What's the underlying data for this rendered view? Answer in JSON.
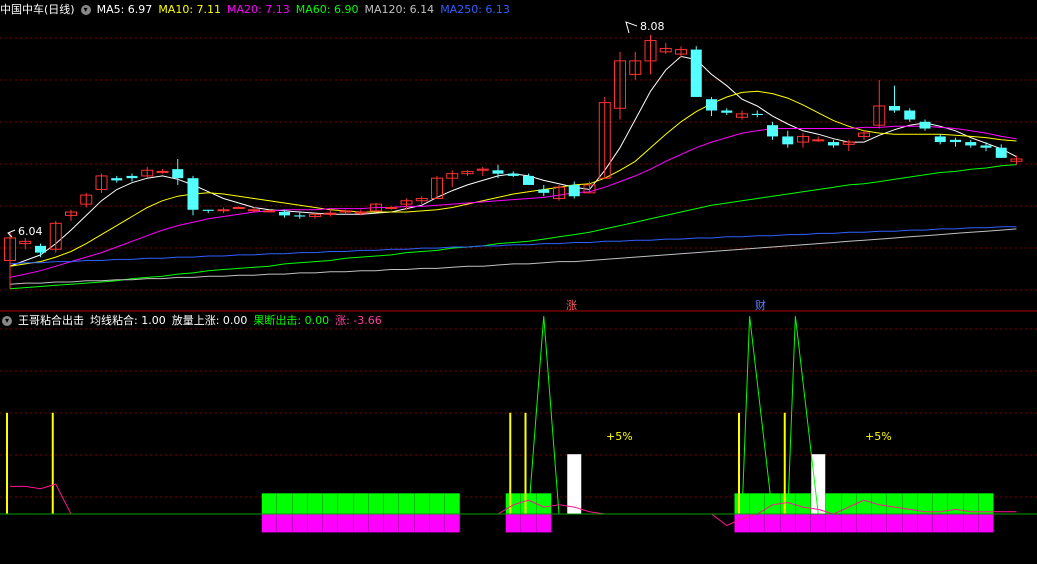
{
  "main_header": {
    "title": "中国中车(日线)",
    "indicators": [
      {
        "label": "MA5: 6.97",
        "color": "#ffffff"
      },
      {
        "label": "MA10: 7.11",
        "color": "#ffff00"
      },
      {
        "label": "MA20: 7.13",
        "color": "#ff00ff"
      },
      {
        "label": "MA60: 6.90",
        "color": "#00ff00"
      },
      {
        "label": "MA120: 6.14",
        "color": "#c0c0c0"
      },
      {
        "label": "MA250: 6.13",
        "color": "#3060ff"
      }
    ]
  },
  "sub_header": {
    "title": "王哥粘合出击",
    "indicators": [
      {
        "label": "均线粘合: 1.00",
        "color": "#ffffff"
      },
      {
        "label": "放量上涨: 0.00",
        "color": "#ffffff"
      },
      {
        "label": "果断出击: 0.00",
        "color": "#00ff00"
      },
      {
        "label": "涨: -3.66",
        "color": "#ff40a0"
      }
    ]
  },
  "annotations": {
    "high_label": "8.08",
    "low_label": "6.04",
    "event_zhang": "涨",
    "event_cai": "财",
    "plus5_a": "+5%",
    "plus5_b": "+5%"
  },
  "colors": {
    "up": "#ff3232",
    "down": "#54ffff",
    "grid": "#800000",
    "ma5": "#ffffff",
    "ma10": "#ffff00",
    "ma20": "#ff00ff",
    "ma60": "#00ff00",
    "ma120": "#c0c0c0",
    "ma250": "#3060ff"
  },
  "chart_data": [
    {
      "type": "candlestick",
      "title": "中国中车(日线)",
      "y_range": [
        5.7,
        8.2
      ],
      "candles": [
        [
          6.05,
          6.3,
          5.8,
          6.25
        ],
        [
          6.2,
          6.25,
          6.15,
          6.22
        ],
        [
          6.18,
          6.2,
          6.08,
          6.12
        ],
        [
          6.15,
          6.4,
          6.12,
          6.38
        ],
        [
          6.45,
          6.5,
          6.4,
          6.48
        ],
        [
          6.55,
          6.65,
          6.52,
          6.63
        ],
        [
          6.68,
          6.82,
          6.65,
          6.8
        ],
        [
          6.78,
          6.8,
          6.74,
          6.76
        ],
        [
          6.8,
          6.82,
          6.75,
          6.78
        ],
        [
          6.8,
          6.88,
          6.78,
          6.85
        ],
        [
          6.84,
          6.86,
          6.82,
          6.84
        ],
        [
          6.86,
          6.95,
          6.72,
          6.78
        ],
        [
          6.78,
          6.8,
          6.45,
          6.5
        ],
        [
          6.5,
          6.5,
          6.47,
          6.49
        ],
        [
          6.5,
          6.52,
          6.47,
          6.5
        ],
        [
          6.52,
          6.53,
          6.51,
          6.52
        ],
        [
          6.5,
          6.52,
          6.48,
          6.5
        ],
        [
          6.49,
          6.5,
          6.48,
          6.49
        ],
        [
          6.48,
          6.5,
          6.43,
          6.45
        ],
        [
          6.45,
          6.48,
          6.42,
          6.44
        ],
        [
          6.44,
          6.47,
          6.42,
          6.46
        ],
        [
          6.46,
          6.5,
          6.44,
          6.47
        ],
        [
          6.48,
          6.5,
          6.46,
          6.49
        ],
        [
          6.47,
          6.5,
          6.45,
          6.48
        ],
        [
          6.49,
          6.56,
          6.48,
          6.55
        ],
        [
          6.52,
          6.53,
          6.5,
          6.52
        ],
        [
          6.55,
          6.6,
          6.5,
          6.58
        ],
        [
          6.58,
          6.62,
          6.55,
          6.6
        ],
        [
          6.6,
          6.8,
          6.6,
          6.78
        ],
        [
          6.78,
          6.85,
          6.7,
          6.82
        ],
        [
          6.82,
          6.85,
          6.8,
          6.84
        ],
        [
          6.85,
          6.88,
          6.8,
          6.86
        ],
        [
          6.85,
          6.9,
          6.78,
          6.82
        ],
        [
          6.82,
          6.84,
          6.79,
          6.8
        ],
        [
          6.8,
          6.82,
          6.72,
          6.72
        ],
        [
          6.68,
          6.72,
          6.62,
          6.65
        ],
        [
          6.6,
          6.72,
          6.58,
          6.7
        ],
        [
          6.72,
          6.75,
          6.6,
          6.62
        ],
        [
          6.65,
          6.75,
          6.65,
          6.72
        ],
        [
          6.78,
          7.5,
          6.78,
          7.45
        ],
        [
          7.4,
          7.9,
          7.3,
          7.82
        ],
        [
          7.7,
          7.9,
          7.65,
          7.82
        ],
        [
          7.82,
          8.05,
          7.7,
          8.0
        ],
        [
          7.9,
          7.98,
          7.88,
          7.93
        ],
        [
          7.88,
          7.95,
          7.85,
          7.92
        ],
        [
          7.92,
          7.95,
          7.5,
          7.5
        ],
        [
          7.48,
          7.5,
          7.33,
          7.38
        ],
        [
          7.38,
          7.4,
          7.34,
          7.36
        ],
        [
          7.32,
          7.38,
          7.3,
          7.35
        ],
        [
          7.35,
          7.38,
          7.32,
          7.34
        ],
        [
          7.25,
          7.28,
          7.12,
          7.15
        ],
        [
          7.15,
          7.2,
          7.05,
          7.08
        ],
        [
          7.1,
          7.18,
          7.05,
          7.15
        ],
        [
          7.12,
          7.15,
          7.1,
          7.12
        ],
        [
          7.1,
          7.12,
          7.05,
          7.07
        ],
        [
          7.08,
          7.12,
          7.02,
          7.1
        ],
        [
          7.15,
          7.2,
          7.12,
          7.18
        ],
        [
          7.25,
          7.65,
          7.22,
          7.42
        ],
        [
          7.42,
          7.6,
          7.36,
          7.38
        ],
        [
          7.38,
          7.4,
          7.28,
          7.3
        ],
        [
          7.28,
          7.3,
          7.2,
          7.22
        ],
        [
          7.15,
          7.17,
          7.08,
          7.1
        ],
        [
          7.12,
          7.14,
          7.06,
          7.1
        ],
        [
          7.1,
          7.12,
          7.05,
          7.07
        ],
        [
          7.07,
          7.1,
          7.02,
          7.05
        ],
        [
          7.05,
          7.08,
          6.96,
          6.96
        ],
        [
          6.93,
          6.98,
          6.9,
          6.95
        ]
      ],
      "x_dates": []
    },
    {
      "type": "line",
      "title": "moving averages",
      "series": [
        {
          "name": "MA5",
          "values": [
            6.0,
            6.05,
            6.1,
            6.2,
            6.32,
            6.45,
            6.58,
            6.68,
            6.74,
            6.78,
            6.8,
            6.77,
            6.72,
            6.66,
            6.6,
            6.56,
            6.52,
            6.5,
            6.49,
            6.48,
            6.47,
            6.46,
            6.46,
            6.46,
            6.47,
            6.48,
            6.51,
            6.54,
            6.61,
            6.67,
            6.72,
            6.76,
            6.8,
            6.82,
            6.8,
            6.76,
            6.73,
            6.7,
            6.68,
            6.85,
            7.05,
            7.3,
            7.55,
            7.74,
            7.86,
            7.83,
            7.7,
            7.6,
            7.48,
            7.42,
            7.33,
            7.26,
            7.2,
            7.17,
            7.13,
            7.1,
            7.1,
            7.16,
            7.21,
            7.25,
            7.27,
            7.24,
            7.2,
            7.14,
            7.09,
            7.04,
            6.97
          ]
        },
        {
          "name": "MA10",
          "values": [
            6.0,
            6.02,
            6.04,
            6.08,
            6.13,
            6.2,
            6.28,
            6.36,
            6.44,
            6.52,
            6.58,
            6.62,
            6.64,
            6.65,
            6.64,
            6.62,
            6.6,
            6.58,
            6.56,
            6.54,
            6.52,
            6.5,
            6.49,
            6.48,
            6.48,
            6.48,
            6.48,
            6.49,
            6.5,
            6.52,
            6.55,
            6.58,
            6.61,
            6.64,
            6.66,
            6.68,
            6.7,
            6.72,
            6.73,
            6.78,
            6.85,
            6.93,
            7.05,
            7.17,
            7.28,
            7.37,
            7.44,
            7.5,
            7.54,
            7.55,
            7.53,
            7.49,
            7.43,
            7.36,
            7.29,
            7.24,
            7.2,
            7.18,
            7.17,
            7.17,
            7.17,
            7.17,
            7.16,
            7.15,
            7.14,
            7.12,
            7.11
          ]
        },
        {
          "name": "MA20",
          "values": [
            5.9,
            5.93,
            5.96,
            6.0,
            6.04,
            6.08,
            6.12,
            6.17,
            6.22,
            6.27,
            6.32,
            6.36,
            6.39,
            6.42,
            6.44,
            6.46,
            6.48,
            6.49,
            6.5,
            6.5,
            6.5,
            6.51,
            6.51,
            6.51,
            6.52,
            6.52,
            6.53,
            6.53,
            6.54,
            6.55,
            6.56,
            6.57,
            6.58,
            6.59,
            6.6,
            6.61,
            6.63,
            6.65,
            6.66,
            6.7,
            6.75,
            6.8,
            6.86,
            6.93,
            6.99,
            7.05,
            7.1,
            7.14,
            7.18,
            7.2,
            7.22,
            7.22,
            7.22,
            7.22,
            7.22,
            7.22,
            7.23,
            7.23,
            7.24,
            7.24,
            7.24,
            7.23,
            7.22,
            7.2,
            7.18,
            7.15,
            7.13
          ]
        },
        {
          "name": "MA60",
          "values": [
            5.8,
            5.81,
            5.82,
            5.83,
            5.84,
            5.85,
            5.86,
            5.87,
            5.89,
            5.9,
            5.91,
            5.93,
            5.94,
            5.96,
            5.97,
            5.98,
            5.99,
            6.0,
            6.02,
            6.03,
            6.04,
            6.05,
            6.07,
            6.08,
            6.09,
            6.1,
            6.12,
            6.13,
            6.14,
            6.16,
            6.17,
            6.18,
            6.2,
            6.21,
            6.22,
            6.24,
            6.26,
            6.28,
            6.3,
            6.33,
            6.36,
            6.39,
            6.42,
            6.45,
            6.48,
            6.51,
            6.54,
            6.56,
            6.58,
            6.6,
            6.62,
            6.64,
            6.66,
            6.68,
            6.7,
            6.72,
            6.73,
            6.75,
            6.77,
            6.79,
            6.81,
            6.83,
            6.84,
            6.86,
            6.87,
            6.89,
            6.9
          ]
        },
        {
          "name": "MA120",
          "values": [
            5.84,
            5.85,
            5.85,
            5.86,
            5.86,
            5.87,
            5.87,
            5.88,
            5.88,
            5.89,
            5.89,
            5.9,
            5.9,
            5.91,
            5.91,
            5.92,
            5.92,
            5.93,
            5.93,
            5.94,
            5.94,
            5.95,
            5.95,
            5.96,
            5.96,
            5.97,
            5.97,
            5.98,
            5.98,
            5.99,
            6.0,
            6.0,
            6.01,
            6.02,
            6.02,
            6.03,
            6.04,
            6.04,
            6.05,
            6.06,
            6.07,
            6.08,
            6.09,
            6.1,
            6.11,
            6.12,
            6.13,
            6.14,
            6.15,
            6.16,
            6.17,
            6.18,
            6.19,
            6.2,
            6.21,
            6.22,
            6.23,
            6.24,
            6.25,
            6.26,
            6.27,
            6.28,
            6.29,
            6.3,
            6.31,
            6.32,
            6.33
          ]
        },
        {
          "name": "MA250",
          "values": [
            6.02,
            6.03,
            6.03,
            6.04,
            6.04,
            6.05,
            6.05,
            6.06,
            6.06,
            6.07,
            6.07,
            6.08,
            6.08,
            6.09,
            6.09,
            6.1,
            6.1,
            6.11,
            6.11,
            6.12,
            6.12,
            6.13,
            6.13,
            6.14,
            6.14,
            6.15,
            6.15,
            6.16,
            6.16,
            6.17,
            6.17,
            6.18,
            6.18,
            6.19,
            6.19,
            6.2,
            6.2,
            6.21,
            6.21,
            6.22,
            6.22,
            6.23,
            6.23,
            6.24,
            6.24,
            6.25,
            6.25,
            6.26,
            6.26,
            6.27,
            6.27,
            6.28,
            6.28,
            6.29,
            6.29,
            6.3,
            6.3,
            6.31,
            6.31,
            6.32,
            6.32,
            6.33,
            6.33,
            6.34,
            6.34,
            6.35,
            6.35
          ]
        }
      ]
    },
    {
      "type": "bar",
      "title": "王哥粘合出击",
      "y_range": [
        -2,
        8
      ],
      "green_bars": [
        17,
        18,
        19,
        20,
        21,
        22,
        23,
        24,
        25,
        26,
        27,
        28,
        29,
        33,
        34,
        35,
        48,
        49,
        50,
        51,
        52,
        53,
        54,
        55,
        56,
        57,
        58,
        59,
        60,
        61,
        62,
        63,
        64
      ],
      "magenta_bars": [
        17,
        18,
        19,
        20,
        21,
        22,
        23,
        24,
        25,
        26,
        27,
        28,
        29,
        33,
        34,
        35,
        48,
        49,
        50,
        51,
        52,
        53,
        54,
        55,
        56,
        57,
        58,
        59,
        60,
        61,
        62,
        63,
        64
      ],
      "yellow_lines": [
        0,
        3,
        33,
        34,
        48,
        51
      ],
      "white_bars": [
        37,
        53
      ],
      "spikes": [
        {
          "start": 34,
          "peak": 35,
          "end": 36
        },
        {
          "start": 48,
          "peak": 48.5,
          "end": 50
        },
        {
          "start": 51,
          "peak": 51.5,
          "end": 53
        }
      ],
      "rise_line": [
        1.2,
        1.2,
        1.1,
        1.3,
        0,
        0,
        0,
        0,
        0,
        0,
        0,
        0,
        0,
        0,
        0,
        0,
        0,
        0,
        0,
        0,
        0,
        0,
        0,
        0,
        0,
        0,
        0,
        0,
        0,
        0,
        0,
        0,
        0,
        0.4,
        0.6,
        0.3,
        0.4,
        0.3,
        0.1,
        0,
        0,
        0,
        0,
        0,
        0,
        0,
        0,
        -0.5,
        -0.2,
        0,
        0.4,
        0.5,
        0.3,
        0.2,
        0,
        0.3,
        0.6,
        0.4,
        0.3,
        0.2,
        0.1,
        0.1,
        0.2,
        0.1,
        0.1,
        0.1,
        0.1
      ]
    }
  ]
}
